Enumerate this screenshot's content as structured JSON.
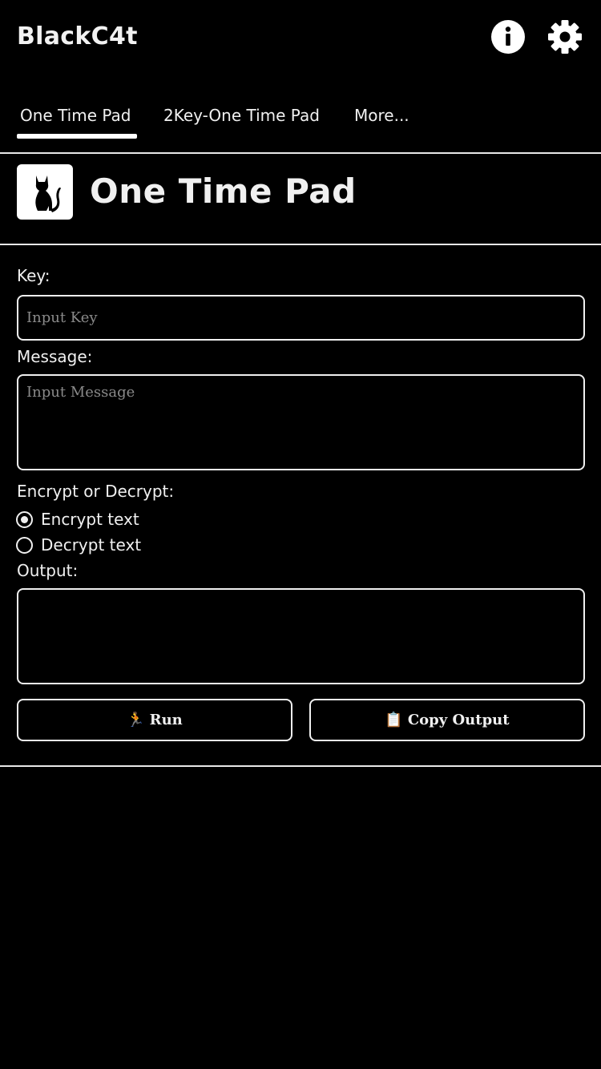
{
  "app": {
    "title": "BlackC4t",
    "info_icon": "info-circle-icon",
    "settings_icon": "gear-icon"
  },
  "tabs": [
    {
      "label": "One Time Pad",
      "active": true
    },
    {
      "label": "2Key-One Time Pad",
      "active": false
    },
    {
      "label": "More...",
      "active": false
    }
  ],
  "hero": {
    "logo_icon": "cat-icon",
    "title": "One Time Pad"
  },
  "form": {
    "key_label": "Key:",
    "key_placeholder": "Input Key",
    "key_value": "",
    "message_label": "Message:",
    "message_placeholder": "Input Message",
    "message_value": "",
    "mode_label": "Encrypt or Decrypt:",
    "mode_options": [
      {
        "label": "Encrypt text",
        "selected": true
      },
      {
        "label": "Decrypt text",
        "selected": false
      }
    ],
    "output_label": "Output:",
    "output_value": ""
  },
  "actions": {
    "run_glyph": "🏃",
    "run_label": "Run",
    "copy_glyph": "📋",
    "copy_label": "Copy Output"
  },
  "colors": {
    "background": "#000000",
    "foreground": "#f0f0f0",
    "placeholder": "#8a8a8a"
  }
}
